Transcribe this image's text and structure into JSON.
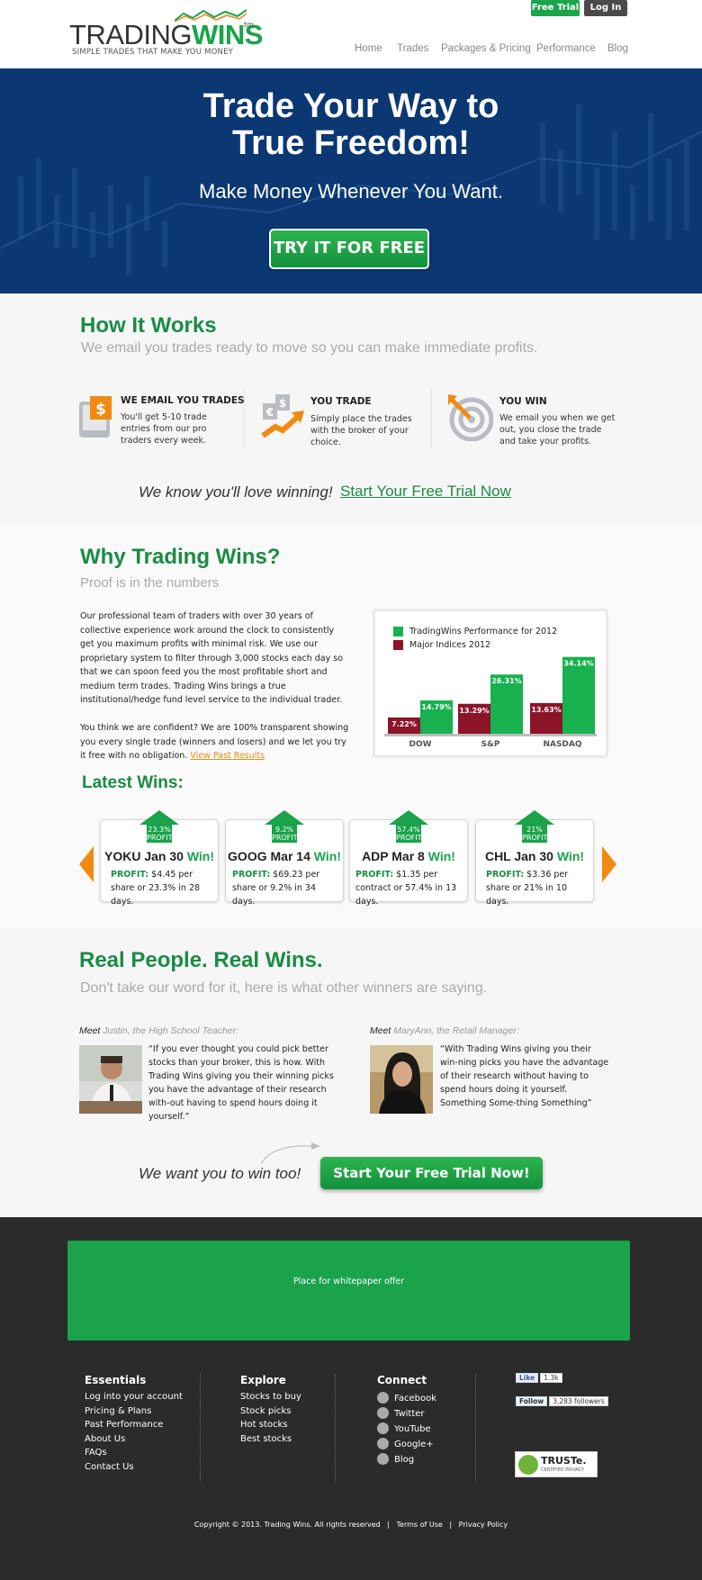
{
  "header": {
    "logo_trading": "TRADING",
    "logo_wins": "WINS",
    "logo_tm": "tm",
    "tagline": "SIMPLE TRADES THAT MAKE YOU MONEY",
    "free_trial": "Free Trial",
    "login": "Log In",
    "nav": [
      "Home",
      "Trades",
      "Packages & Pricing",
      "Performance",
      "Blog"
    ]
  },
  "hero": {
    "title_line1": "Trade Your Way to",
    "title_line2": "True Freedom!",
    "subtitle": "Make Money Whenever You Want.",
    "cta": "TRY IT FOR FREE"
  },
  "how": {
    "title": "How It Works",
    "subtitle": "We email you trades ready to move so you can make immediate profits.",
    "steps": [
      {
        "title": "WE EMAIL YOU TRADES",
        "text": "You'll get 5-10 trade entries from our pro traders every week.",
        "icon": "email-trade-icon"
      },
      {
        "title": "YOU TRADE",
        "text": "Simply place the trades with the broker of your choice.",
        "icon": "trade-icon"
      },
      {
        "title": "YOU WIN",
        "text": "We email you when we get out, you close the trade and take your profits.",
        "icon": "target-icon"
      }
    ],
    "love_text": "We know you'll love winning!",
    "trial_link": "Start Your Free Trial Now"
  },
  "why": {
    "title": "Why Trading Wins?",
    "subtitle": "Proof is in the numbers",
    "para1": "Our professional team of traders with over 30 years of collective experience work around the clock to consistently get you maximum profits with minimal risk.   We use our proprietary system to filter through 3,000 stocks each day so that we can spoon feed you the most profitable short and medium term trades.  Trading Wins brings a true institutional/hedge fund level service to the individual trader.",
    "para2": "You think we are confident?  We are 100% transparent showing you every single trade (winners and losers) and we let you try it free with no obligation.",
    "past_link": "View Past Results"
  },
  "chart_data": {
    "type": "bar",
    "categories": [
      "DOW",
      "S&P",
      "NASDAQ"
    ],
    "series": [
      {
        "name": "TradingWins Performance for 2012",
        "values": [
          14.79,
          26.31,
          34.14
        ],
        "labels": [
          "14.79%",
          "26.31%",
          "34.14%"
        ],
        "color": "#17b24f"
      },
      {
        "name": "Major Indices 2012",
        "values": [
          7.22,
          13.29,
          13.63
        ],
        "labels": [
          "7.22%",
          "13.29%",
          "13.63%"
        ],
        "color": "#8b1427"
      }
    ],
    "ylim": [
      0,
      36
    ],
    "legend": "top-left",
    "grid": false
  },
  "wins": {
    "title": "Latest Wins:",
    "win_word": "Win!",
    "profit_label": "PROFIT:",
    "cards": [
      {
        "pct": "23.3%",
        "badge": "PROFIT",
        "ticker": "YOKU Jan 30",
        "detail": "$4.45 per share or 23.3% in 28 days."
      },
      {
        "pct": "9.2%",
        "badge": "PROFIT",
        "ticker": "GOOG Mar 14",
        "detail": "$69.23 per share or 9.2% in 34 days."
      },
      {
        "pct": "57.4%",
        "badge": "PROFIT",
        "ticker": "ADP Mar 8",
        "detail": "$1.35 per contract or 57.4% in 13 days."
      },
      {
        "pct": "21%",
        "badge": "PROFIT",
        "ticker": "CHL Jan 30",
        "detail": "$3.36 per share or 21% in 10 days."
      }
    ]
  },
  "people": {
    "title": "Real People. Real Wins.",
    "subtitle": "Don't take our word for it, here is what other winners are saying.",
    "meet": "Meet",
    "testimonials": [
      {
        "who": "Justin, the High School Teacher:",
        "quote": "“If you ever thought you could pick better stocks than your broker, this is how. With Trading Wins giving you their winning picks you have the advantage of their research with-out having to spend hours doing it yourself.”"
      },
      {
        "who": "MaryAnn, the Retail Manager:",
        "quote": "“With Trading Wins giving you their win-ning picks you have the advantage of their research without having to spend hours doing it yourself. Something Some-thing Something”"
      }
    ],
    "want_text": "We want you to win too!",
    "cta": "Start Your Free Trial Now!"
  },
  "footer": {
    "whitepaper": "Place for whitepaper offer",
    "essentials": {
      "title": "Essentials",
      "links": [
        "Log into your account",
        "Pricing & Plans",
        "Past Performance",
        "About Us",
        "FAQs",
        "Contact Us"
      ]
    },
    "explore": {
      "title": "Explore",
      "links": [
        "Stocks to buy",
        "Stock picks",
        "Hot stocks",
        "Best stocks"
      ]
    },
    "connect": {
      "title": "Connect",
      "links": [
        "Facebook",
        "Twitter",
        "YouTube",
        "Google+",
        "Blog"
      ]
    },
    "fb_like": "Like",
    "fb_count": "1.3k",
    "tw_follow": "Follow",
    "tw_count": "3,283 followers",
    "truste": "TRUSTe.",
    "truste_sub": "CERTIFIED PRIVACY",
    "copyright": "Copyright © 2013. Trading Wins. All rights reserved",
    "terms": "Terms of Use",
    "privacy": "Privacy Policy",
    "sep": "|"
  }
}
